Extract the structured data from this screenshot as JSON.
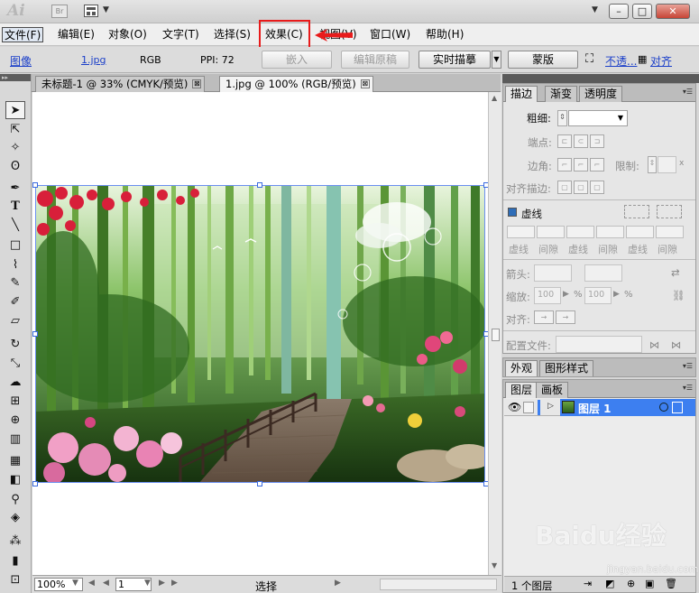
{
  "titlebar": {
    "app_logo": "Ai",
    "bridge_label": "Br",
    "window_controls": {
      "minimize": "–",
      "restore": "□",
      "close": "✕"
    }
  },
  "menu": {
    "items": [
      "文件(F)",
      "编辑(E)",
      "对象(O)",
      "文字(T)",
      "选择(S)",
      "效果(C)",
      "视图(V)",
      "窗口(W)",
      "帮助(H)"
    ]
  },
  "control_bar": {
    "object_type": "图像",
    "file_link": "1.jpg",
    "color_mode": "RGB",
    "ppi": "PPI: 72",
    "embed_button": "嵌入",
    "edit_original_button": "编辑原稿",
    "live_trace_button": "实时描摹",
    "mask_button": "蒙版",
    "opacity_link": "不透...",
    "align_link": "对齐"
  },
  "doc_tabs": [
    {
      "label": "未标题-1 @ 33% (CMYK/预览)",
      "close": "⊠"
    },
    {
      "label": "1.jpg @ 100% (RGB/预览)",
      "close": "⊠"
    }
  ],
  "status_bar": {
    "zoom": "100%",
    "page": "1",
    "tool_label": "选择"
  },
  "stroke_panel": {
    "tabs": [
      "描边",
      "渐变",
      "透明度"
    ],
    "weight_label": "粗细:",
    "cap_label": "端点:",
    "corner_label": "边角:",
    "limit_label": "限制:",
    "limit_suffix": "x",
    "align_stroke_label": "对齐描边:",
    "dashed_label": "虚线",
    "dash_labels": [
      "虚线",
      "间隙",
      "虚线",
      "间隙",
      "虚线",
      "间隙"
    ],
    "arrowheads_label": "箭头:",
    "scale_label": "缩放:",
    "scale_values": [
      "100",
      "100"
    ],
    "percent": "%",
    "align_label": "对齐:",
    "profile_label": "配置文件:"
  },
  "appearance_panel": {
    "tabs": [
      "外观",
      "图形样式"
    ]
  },
  "layers_panel": {
    "tabs": [
      "图层",
      "画板"
    ],
    "layer_name": "图层 1",
    "footer": "1 个图层"
  },
  "watermark": {
    "brand": "Baidu经验",
    "url": "jingyan.baidu.com"
  },
  "colors": {
    "highlight_red": "#e81b1b",
    "selection_blue": "#3d7ff0",
    "link_blue": "#1b3fc9"
  }
}
